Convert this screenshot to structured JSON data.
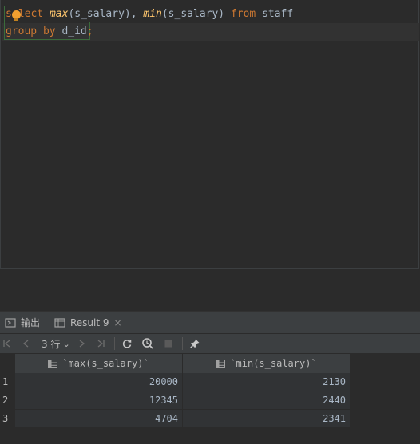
{
  "editor": {
    "line1": {
      "t1": "s",
      "t1b": "lect",
      "t2": " ",
      "t3": "max",
      "t4": "(s_salary), ",
      "t5": "min",
      "t6": "(s_salary) ",
      "t7": "from",
      "t8": " staff"
    },
    "line2": {
      "t1": "group by",
      "t2": " d_id",
      "t3": ";"
    },
    "intention_icon": "lightbulb-icon"
  },
  "tool_window": {
    "tabs": [
      {
        "label": "输出",
        "icon": "output-icon"
      },
      {
        "label": "Result 9",
        "icon": "table-icon",
        "close": "×"
      }
    ]
  },
  "toolbar": {
    "rows_label": "3 行",
    "rows_chevron": "⌄",
    "buttons": [
      "first-page-icon",
      "prev-page-icon",
      "next-page-icon",
      "last-page-icon",
      "refresh-icon",
      "explain-icon",
      "stop-icon",
      "pin-icon"
    ]
  },
  "table": {
    "columns": [
      "`max(s_salary)`",
      "`min(s_salary)`"
    ],
    "rows": [
      {
        "num": "1",
        "max": "20000",
        "min": "2130"
      },
      {
        "num": "2",
        "max": "12345",
        "min": "2440"
      },
      {
        "num": "3",
        "max": "4704",
        "min": "2341"
      }
    ]
  },
  "colors": {
    "background": "#2b2b2b",
    "keyword": "#cc7832",
    "function": "#ffc66d",
    "text": "#a9b7c6"
  }
}
